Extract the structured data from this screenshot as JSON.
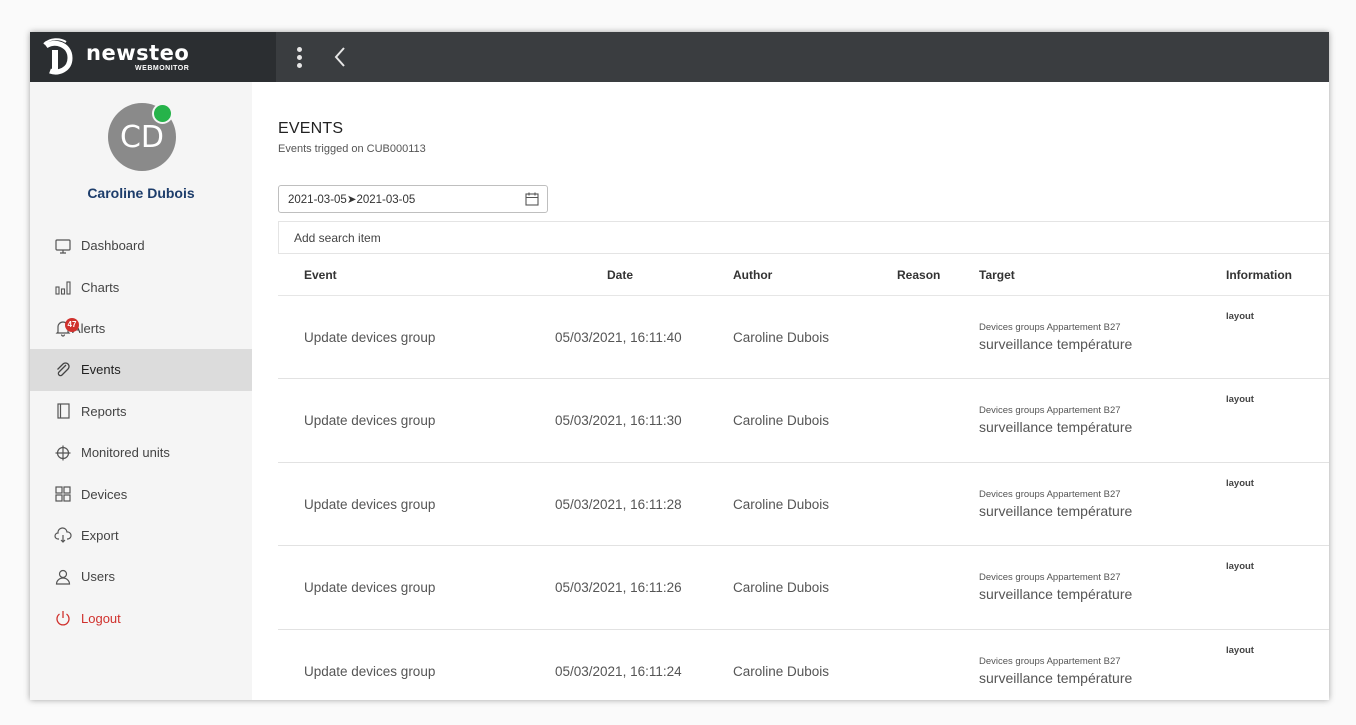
{
  "app": {
    "brand_name": "newsteo",
    "brand_sub": "WEBMONITOR"
  },
  "colors": {
    "topbar": "#3a3d40",
    "sidebar": "#f5f5f5",
    "status_online": "#26b34a",
    "user_name": "#1d3d6b",
    "logout": "#d0312d",
    "badge": "#d0312d"
  },
  "user": {
    "initials": "CD",
    "name": "Caroline Dubois",
    "status": "online"
  },
  "sidebar": {
    "items": [
      {
        "label": "Dashboard",
        "icon": "monitor-icon"
      },
      {
        "label": "Charts",
        "icon": "bar-chart-icon"
      },
      {
        "label": "Alerts",
        "icon": "bell-icon",
        "badge": "47"
      },
      {
        "label": "Events",
        "icon": "paperclip-icon",
        "active": true
      },
      {
        "label": "Reports",
        "icon": "report-icon"
      },
      {
        "label": "Monitored units",
        "icon": "crosshair-icon"
      },
      {
        "label": "Devices",
        "icon": "grid-icon"
      },
      {
        "label": "Export",
        "icon": "cloud-download-icon"
      },
      {
        "label": "Users",
        "icon": "user-icon"
      },
      {
        "label": "Logout",
        "icon": "power-icon"
      }
    ]
  },
  "page": {
    "title": "EVENTS",
    "subtitle": "Events trigged on CUB000113",
    "date_range": "2021-03-05➤2021-03-05",
    "search_placeholder": "Add search item"
  },
  "table": {
    "columns": [
      "Event",
      "Date",
      "Author",
      "Reason",
      "Target",
      "Information"
    ],
    "rows": [
      {
        "event": "Update devices group",
        "date": "05/03/2021, 16:11:40",
        "author": "Caroline Dubois",
        "reason": "",
        "target_small": "Devices groups Appartement B27",
        "target": "surveillance température",
        "information": "layout"
      },
      {
        "event": "Update devices group",
        "date": "05/03/2021, 16:11:30",
        "author": "Caroline Dubois",
        "reason": "",
        "target_small": "Devices groups Appartement B27",
        "target": "surveillance température",
        "information": "layout"
      },
      {
        "event": "Update devices group",
        "date": "05/03/2021, 16:11:28",
        "author": "Caroline Dubois",
        "reason": "",
        "target_small": "Devices groups Appartement B27",
        "target": "surveillance température",
        "information": "layout"
      },
      {
        "event": "Update devices group",
        "date": "05/03/2021, 16:11:26",
        "author": "Caroline Dubois",
        "reason": "",
        "target_small": "Devices groups Appartement B27",
        "target": "surveillance température",
        "information": "layout"
      },
      {
        "event": "Update devices group",
        "date": "05/03/2021, 16:11:24",
        "author": "Caroline Dubois",
        "reason": "",
        "target_small": "Devices groups Appartement B27",
        "target": "surveillance température",
        "information": "layout"
      }
    ]
  }
}
